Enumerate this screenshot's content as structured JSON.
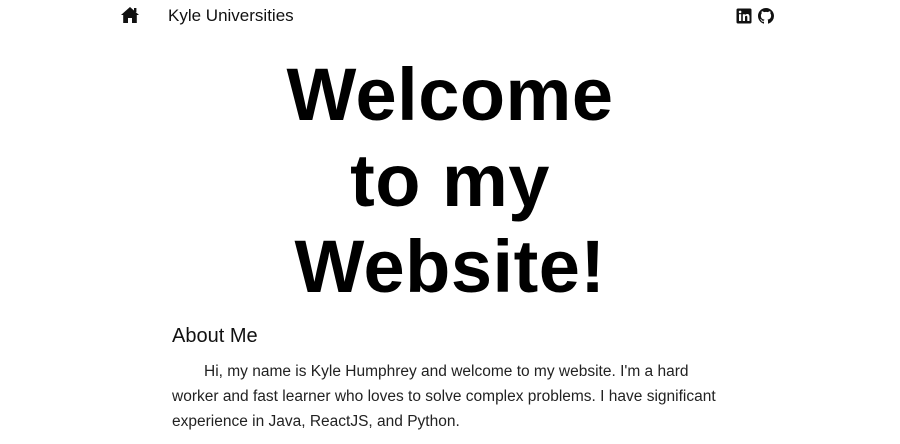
{
  "navbar": {
    "home_icon": "home-icon",
    "brand": "Kyle Universities",
    "social": [
      {
        "icon": "linkedin-icon"
      },
      {
        "icon": "github-icon"
      }
    ]
  },
  "hero": {
    "lines": [
      "Welcome",
      "to my",
      "Website!"
    ]
  },
  "about": {
    "heading": "About Me",
    "text": "Hi, my name is Kyle Humphrey and welcome to my website. I'm a hard worker and fast learner who loves to solve complex problems. I have significant experience in Java, ReactJS, and Python."
  },
  "colors": {
    "text": "#111111",
    "background": "#ffffff"
  }
}
